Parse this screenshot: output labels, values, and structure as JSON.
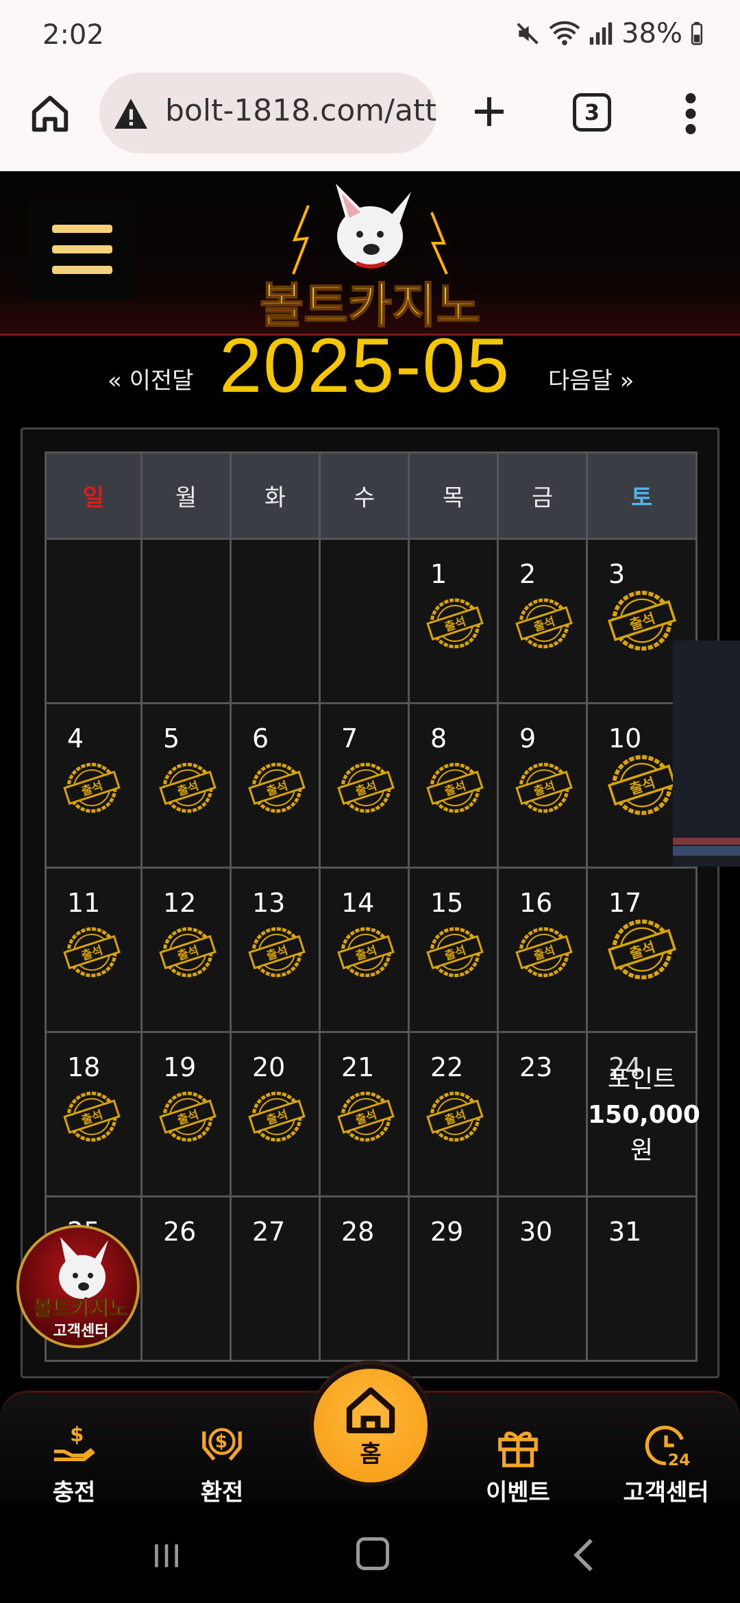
{
  "status": {
    "time": "2:02",
    "battery": "38%"
  },
  "browser": {
    "url": "bolt-1818.com/att",
    "tab_count": "3"
  },
  "site": {
    "brand": "볼트카지노"
  },
  "month_nav": {
    "prev_label": "« 이전달",
    "title": "2025-05",
    "next_label": "다음달 »"
  },
  "calendar": {
    "weekdays": [
      "일",
      "월",
      "화",
      "수",
      "목",
      "금",
      "토"
    ],
    "weekday_colors": {
      "sunday": "#e21a1a",
      "saturday": "#4fb7e8"
    },
    "stamp_label": "출석",
    "weeks": [
      [
        {
          "d": "",
          "s": false
        },
        {
          "d": "",
          "s": false
        },
        {
          "d": "",
          "s": false
        },
        {
          "d": "",
          "s": false
        },
        {
          "d": "1",
          "s": true
        },
        {
          "d": "2",
          "s": true
        },
        {
          "d": "3",
          "s": true
        }
      ],
      [
        {
          "d": "4",
          "s": true
        },
        {
          "d": "5",
          "s": true
        },
        {
          "d": "6",
          "s": true
        },
        {
          "d": "7",
          "s": true
        },
        {
          "d": "8",
          "s": true
        },
        {
          "d": "9",
          "s": true
        },
        {
          "d": "10",
          "s": true
        }
      ],
      [
        {
          "d": "11",
          "s": true
        },
        {
          "d": "12",
          "s": true
        },
        {
          "d": "13",
          "s": true
        },
        {
          "d": "14",
          "s": true
        },
        {
          "d": "15",
          "s": true
        },
        {
          "d": "16",
          "s": true
        },
        {
          "d": "17",
          "s": true
        }
      ],
      [
        {
          "d": "18",
          "s": true
        },
        {
          "d": "19",
          "s": true
        },
        {
          "d": "20",
          "s": true
        },
        {
          "d": "21",
          "s": true
        },
        {
          "d": "22",
          "s": true
        },
        {
          "d": "23",
          "s": false
        },
        {
          "d": "24",
          "s": false,
          "reward": [
            "포인트",
            "150,000",
            "원"
          ]
        }
      ],
      [
        {
          "d": "25",
          "s": false
        },
        {
          "d": "26",
          "s": false
        },
        {
          "d": "27",
          "s": false
        },
        {
          "d": "28",
          "s": false
        },
        {
          "d": "29",
          "s": false
        },
        {
          "d": "30",
          "s": false
        },
        {
          "d": "31",
          "s": false
        }
      ]
    ]
  },
  "float_cs": {
    "brand": "볼트카지노",
    "label": "고객센터"
  },
  "bottom_nav": {
    "charge": "충전",
    "exchange": "환전",
    "home": "홈",
    "event": "이벤트",
    "support": "고객센터"
  },
  "colors": {
    "accent": "#f6c600",
    "home_button": "#f5a623"
  }
}
